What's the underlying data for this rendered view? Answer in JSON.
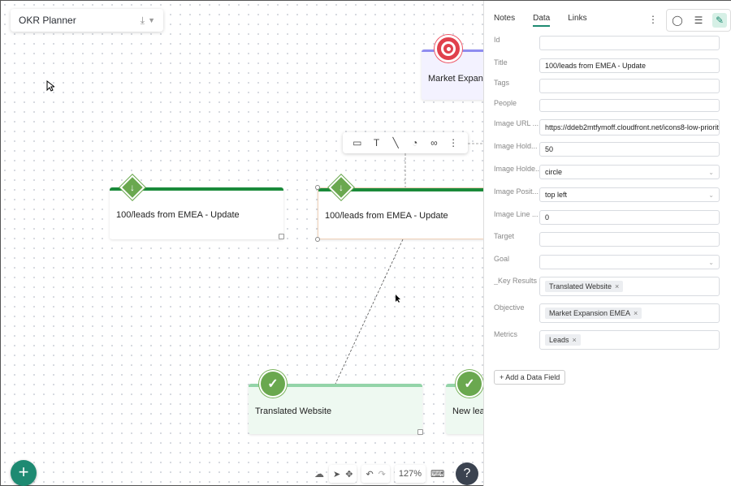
{
  "app": {
    "title": "OKR Planner"
  },
  "canvas": {
    "nodes": [
      {
        "label": "100/leads from EMEA - Update"
      },
      {
        "label": "100/leads from EMEA - Update"
      },
      {
        "label": "Translated Website"
      },
      {
        "label": "New lea"
      },
      {
        "label": "Market Expans"
      }
    ]
  },
  "bottom": {
    "zoom": "127%",
    "help": "?",
    "add": "+"
  },
  "panel": {
    "tabs": [
      "Notes",
      "Data",
      "Links"
    ],
    "active_tab": "Data",
    "fields": {
      "id": {
        "label": "Id",
        "value": ""
      },
      "title": {
        "label": "Title",
        "value": "100/leads from EMEA - Update"
      },
      "tags": {
        "label": "Tags",
        "value": ""
      },
      "people": {
        "label": "People",
        "value": ""
      },
      "image_url": {
        "label": "Image URL ...",
        "value": "https://ddeb2mtfymoff.cloudfront.net/icons8-low-priority"
      },
      "image_hold": {
        "label": "Image Hold...",
        "value": "50"
      },
      "image_holder_shape": {
        "label": "Image Holde...",
        "value": "circle"
      },
      "image_position": {
        "label": "Image Posit...",
        "value": "top left"
      },
      "image_line": {
        "label": "Image Line ...",
        "value": "0"
      },
      "target": {
        "label": "Target",
        "value": ""
      },
      "goal": {
        "label": "Goal",
        "value": ""
      },
      "key_results": {
        "label": "_Key Results",
        "chips": [
          "Translated Website"
        ]
      },
      "objective": {
        "label": "Objective",
        "chips": [
          "Market Expansion EMEA"
        ]
      },
      "metrics": {
        "label": "Metrics",
        "chips": [
          "Leads"
        ]
      }
    },
    "add_field": "+ Add a Data Field"
  },
  "colors": {
    "green": "#1e8a72",
    "node_bar": "#1a8a3a",
    "light_bar": "#93d4a8",
    "accent_purple": "#8e8cf0"
  }
}
